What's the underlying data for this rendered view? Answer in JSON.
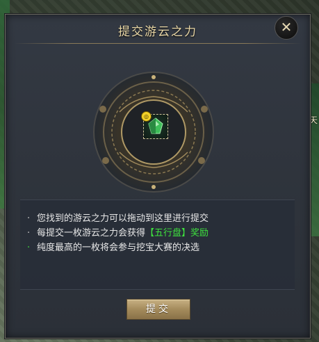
{
  "dialog": {
    "title": "提交游云之力",
    "close_symbol": "✕",
    "submit_label": "提交"
  },
  "info_lines": [
    {
      "text": "您找到的游云之力可以拖动到这里进行提交"
    },
    {
      "text_prefix": "每提交一枚游云之力会获得",
      "highlight": "【五行盘】奖励"
    },
    {
      "text": "纯度最高的一枚将会参与挖宝大赛的决选"
    }
  ],
  "side_text": "天",
  "icons": {
    "close": "close-icon",
    "gem": "green-crystal-icon",
    "bind": "lock-badge-icon"
  },
  "colors": {
    "title": "#e9d7a6",
    "highlight": "#3ee23e",
    "panel": "#2e333b",
    "button": "#a48b5c"
  }
}
